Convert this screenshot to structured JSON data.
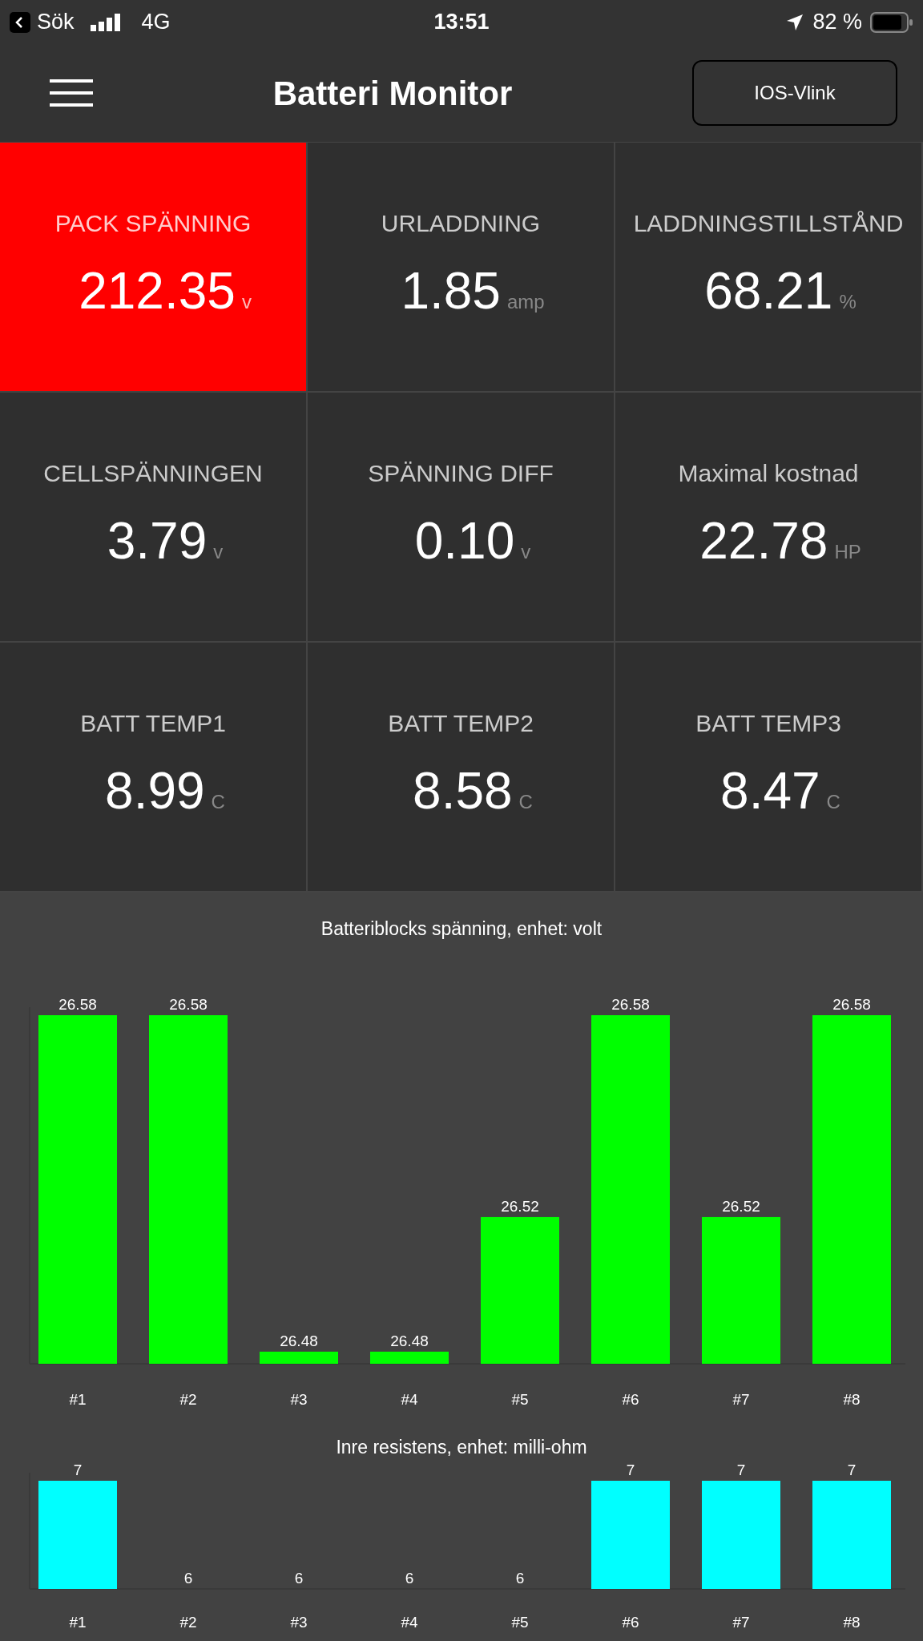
{
  "status_bar": {
    "back_label": "Sök",
    "network": "4G",
    "time": "13:51",
    "battery": "82 %"
  },
  "header": {
    "title": "Batteri Monitor",
    "button": "IOS-Vlink"
  },
  "tiles": [
    {
      "label": "PACK SPÄNNING",
      "value": "212.35",
      "unit": "v",
      "alert": true
    },
    {
      "label": "URLADDNING",
      "value": "1.85",
      "unit": "amp",
      "alert": false
    },
    {
      "label": "LADDNINGSTILLSTÅND",
      "value": "68.21",
      "unit": "%",
      "alert": false
    },
    {
      "label": "CELLSPÄNNINGEN",
      "value": "3.79",
      "unit": "v",
      "alert": false
    },
    {
      "label": "SPÄNNING DIFF",
      "value": "0.10",
      "unit": "v",
      "alert": false
    },
    {
      "label": "Maximal kostnad",
      "value": "22.78",
      "unit": "HP",
      "alert": false
    },
    {
      "label": "BATT TEMP1",
      "value": "8.99",
      "unit": "C",
      "alert": false
    },
    {
      "label": "BATT TEMP2",
      "value": "8.58",
      "unit": "C",
      "alert": false
    },
    {
      "label": "BATT TEMP3",
      "value": "8.47",
      "unit": "C",
      "alert": false
    }
  ],
  "charts": [
    {
      "chart_data": {
        "type": "bar",
        "title": "Batteriblocks spänning, enhet: volt",
        "categories": [
          "#1",
          "#2",
          "#3",
          "#4",
          "#5",
          "#6",
          "#7",
          "#8"
        ],
        "series": [
          {
            "color": "#00ff00",
            "values": [
              26.58,
              26.58,
              26.48,
              26.48,
              26.52,
              26.58,
              26.52,
              26.58
            ]
          }
        ],
        "ylim": [
          26.4764,
          26.58
        ],
        "data_labels": true,
        "value_labels": [
          "26.58",
          "26.58",
          "26.48",
          "26.48",
          "26.52",
          "26.58",
          "26.52",
          "26.58"
        ]
      }
    },
    {
      "chart_data": {
        "type": "bar",
        "title": "Inre resistens, enhet: milli-ohm",
        "categories": [
          "#1",
          "#2",
          "#3",
          "#4",
          "#5",
          "#6",
          "#7",
          "#8"
        ],
        "series": [
          {
            "color": "#00ffff",
            "values": [
              7,
              6,
              6,
              6,
              6,
              7,
              7,
              7
            ]
          }
        ],
        "ylim": [
          6,
          7
        ],
        "data_labels": true,
        "value_labels": [
          "7",
          "6",
          "6",
          "6",
          "6",
          "7",
          "7",
          "7"
        ]
      }
    }
  ]
}
